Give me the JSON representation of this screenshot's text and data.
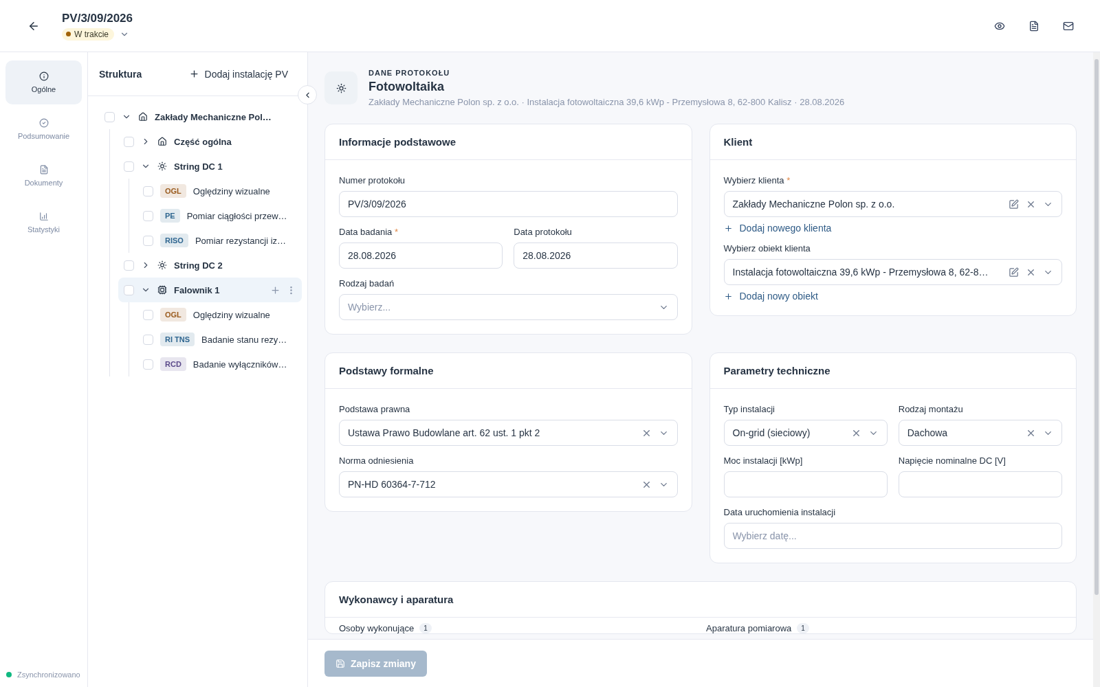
{
  "header": {
    "title": "PV/3/09/2026",
    "status": {
      "label": "W trakcie",
      "color": "#a16207"
    },
    "actions": [
      {
        "kind": "preview"
      },
      {
        "kind": "pdf"
      },
      {
        "kind": "mail"
      }
    ]
  },
  "nav": {
    "items": [
      {
        "label": "Ogólne",
        "selected": true
      },
      {
        "label": "Podsumowanie",
        "selected": false
      },
      {
        "label": "Dokumenty",
        "selected": false
      },
      {
        "label": "Statystyki",
        "selected": false
      }
    ],
    "sync": {
      "label": "Zsynchronizowano",
      "color": "#10b981"
    }
  },
  "tree": {
    "title": "Struktura",
    "add_button": "Dodaj instalację PV",
    "items": [
      {
        "kind": "site",
        "label": "Zakłady Mechaniczne Pol…",
        "checked": false,
        "expanded": true,
        "selected": false,
        "children": [
          {
            "kind": "site",
            "label": "Część ogólna",
            "checked": false,
            "expanded": false,
            "selected": false
          },
          {
            "kind": "string",
            "label": "String DC 1",
            "checked": false,
            "expanded": true,
            "selected": false,
            "children": [
              {
                "kind": "test",
                "tag": "OGL",
                "color": "#9a5b1e",
                "label": "Oględziny wizualne",
                "checked": false
              },
              {
                "kind": "test",
                "tag": "PE",
                "color": "#2f6690",
                "label": "Pomiar ciągłości przew…",
                "checked": false
              },
              {
                "kind": "test",
                "tag": "RISO",
                "color": "#2f6690",
                "label": "Pomiar rezystancji iz…",
                "checked": false
              }
            ]
          },
          {
            "kind": "string",
            "label": "String DC 2",
            "checked": false,
            "expanded": false,
            "selected": false
          },
          {
            "kind": "inverter",
            "label": "Falownik 1",
            "checked": false,
            "expanded": true,
            "selected": true,
            "children": [
              {
                "kind": "test",
                "tag": "OGL",
                "color": "#9a5b1e",
                "label": "Oględziny wizualne",
                "checked": false
              },
              {
                "kind": "test",
                "tag": "RI TNS",
                "color": "#2f6690",
                "label": "Badanie stanu rezy…",
                "checked": false
              },
              {
                "kind": "test",
                "tag": "RCD",
                "color": "#5b4a8a",
                "label": "Badanie wyłączników…",
                "checked": false
              }
            ]
          }
        ]
      }
    ]
  },
  "protocol": {
    "eyebrow": "DANE PROTOKOŁU",
    "title": "Fotowoltaika",
    "subtitle": "Zakłady Mechaniczne Polon sp. z o.o. · Instalacja fotowoltaiczna 39,6 kWp - Przemysłowa 8, 62-800 Kalisz · 28.08.2026"
  },
  "cards": [
    {
      "title": "Informacje podstawowe",
      "items": [
        {
          "kind": "field",
          "field": {
            "kind": "input",
            "label": "Numer protokołu",
            "value": "PV/3/09/2026"
          }
        },
        {
          "kind": "pair",
          "fields": [
            {
              "kind": "input",
              "label": "Data badania",
              "required_mark": "*",
              "value": "28.08.2026"
            },
            {
              "kind": "input",
              "label": "Data protokołu",
              "value": "28.08.2026"
            }
          ]
        },
        {
          "kind": "field",
          "field": {
            "kind": "select",
            "label": "Rodzaj badań",
            "placeholder": "Wybierz...",
            "clearable": false,
            "editable": false
          }
        }
      ]
    },
    {
      "title": "Klient",
      "items": [
        {
          "kind": "field",
          "field": {
            "kind": "select",
            "label": "Wybierz klienta",
            "required_mark": "*",
            "value": "Zakłady Mechaniczne Polon sp. z o.o.",
            "clearable": true,
            "editable": true
          }
        },
        {
          "kind": "link",
          "label": "Dodaj nowego klienta"
        },
        {
          "kind": "field",
          "field": {
            "kind": "select",
            "label": "Wybierz obiekt klienta",
            "value": "Instalacja fotowoltaiczna 39,6 kWp - Przemysłowa 8, 62-8…",
            "clearable": true,
            "editable": true
          }
        },
        {
          "kind": "link",
          "label": "Dodaj nowy obiekt"
        }
      ]
    },
    {
      "title": "Podstawy formalne",
      "items": [
        {
          "kind": "field",
          "field": {
            "kind": "select",
            "label": "Podstawa prawna",
            "value": "Ustawa Prawo Budowlane art. 62 ust. 1 pkt 2",
            "clearable": true,
            "editable": false
          }
        },
        {
          "kind": "field",
          "field": {
            "kind": "select",
            "label": "Norma odniesienia",
            "value": "PN-HD 60364-7-712",
            "clearable": true,
            "editable": false
          }
        }
      ]
    },
    {
      "title": "Parametry techniczne",
      "items": [
        {
          "kind": "pair",
          "fields": [
            {
              "kind": "select",
              "label": "Typ instalacji",
              "value": "On-grid (sieciowy)",
              "clearable": true,
              "editable": false
            },
            {
              "kind": "select",
              "label": "Rodzaj montażu",
              "value": "Dachowa",
              "clearable": true,
              "editable": false
            }
          ]
        },
        {
          "kind": "pair",
          "fields": [
            {
              "kind": "input",
              "label": "Moc instalacji [kWp]"
            },
            {
              "kind": "input",
              "label": "Napięcie nominalne DC [V]"
            }
          ]
        },
        {
          "kind": "field",
          "field": {
            "kind": "input",
            "label": "Data uruchomienia instalacji",
            "placeholder": "Wybierz datę..."
          }
        }
      ]
    }
  ],
  "wide_card": {
    "title": "Wykonawcy i aparatura",
    "sections": [
      {
        "label": "Osoby wykonujące",
        "count": "1"
      },
      {
        "label": "Aparatura pomiarowa",
        "count": "1"
      }
    ]
  },
  "footer": {
    "save_button": {
      "label": "Zapisz zmiany",
      "disabled": true
    }
  }
}
